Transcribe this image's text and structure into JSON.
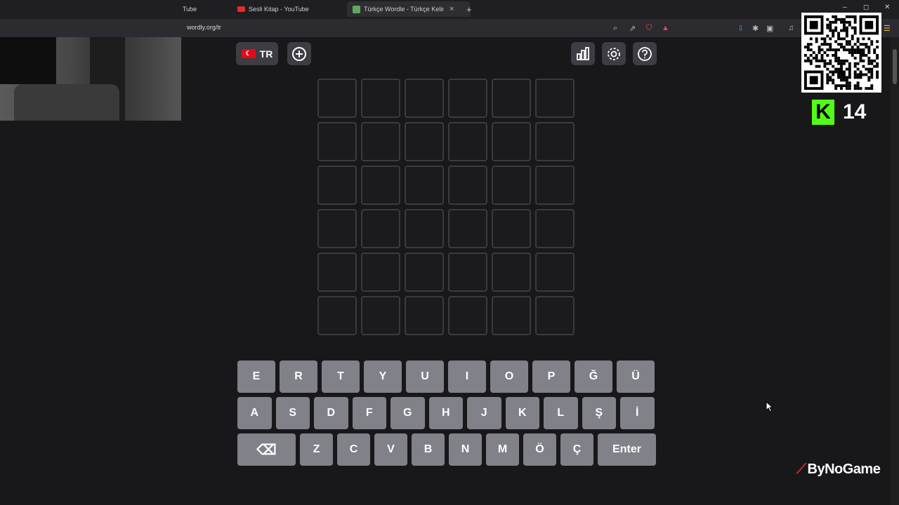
{
  "browser": {
    "tabs": [
      {
        "label": "Tube",
        "favicon": "youtube-icon"
      },
      {
        "label": "Sesli Kitap - YouTube",
        "favicon": "youtube-icon"
      },
      {
        "label": "Türkçe Wordle - Türkçe Kelimel",
        "favicon": "wordle-icon",
        "active": true
      }
    ],
    "new_tab": "+",
    "url": "wordly.org/tr",
    "window_controls": [
      "–",
      "◻",
      "✕"
    ]
  },
  "game": {
    "language_label": "TR",
    "flag_glyph": "☾",
    "rows": 6,
    "cols": 6,
    "keyboard": {
      "row1": [
        "E",
        "R",
        "T",
        "Y",
        "U",
        "I",
        "O",
        "P",
        "Ğ",
        "Ü"
      ],
      "row2": [
        "A",
        "S",
        "D",
        "F",
        "G",
        "H",
        "J",
        "K",
        "L",
        "Ş",
        "İ"
      ],
      "row3_letters": [
        "Z",
        "C",
        "V",
        "B",
        "N",
        "M",
        "Ö",
        "Ç"
      ],
      "enter": "Enter",
      "backspace": "⌫"
    }
  },
  "overlay": {
    "kick_letter": "K",
    "viewer_count": "14",
    "brand": "ByNoGame",
    "brand_mark": "⟋"
  },
  "colors": {
    "background": "#18181b",
    "key": "#818189",
    "kick_green": "#53fc18",
    "tile_border": "#3a3a3f"
  }
}
